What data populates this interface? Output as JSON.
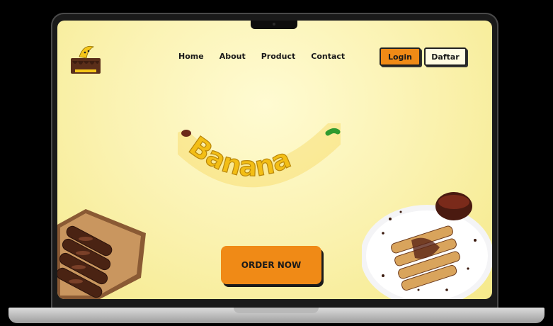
{
  "brand": {
    "logo_text": "Banana"
  },
  "nav": {
    "items": [
      {
        "label": "Home"
      },
      {
        "label": "About"
      },
      {
        "label": "Product"
      },
      {
        "label": "Contact"
      }
    ]
  },
  "auth": {
    "login_label": "Login",
    "register_label": "Daftar"
  },
  "hero": {
    "title": "Banana",
    "order_label": "ORDER NOW"
  },
  "colors": {
    "accent": "#f08a16",
    "background": "#fbf3b4",
    "chocolate": "#5a2e1a",
    "banana": "#f5c518"
  },
  "icons": {
    "logo": "banana-logo-icon",
    "product_left": "chocolate-banana-box-image",
    "product_right": "chocolate-crepes-plate-image"
  }
}
